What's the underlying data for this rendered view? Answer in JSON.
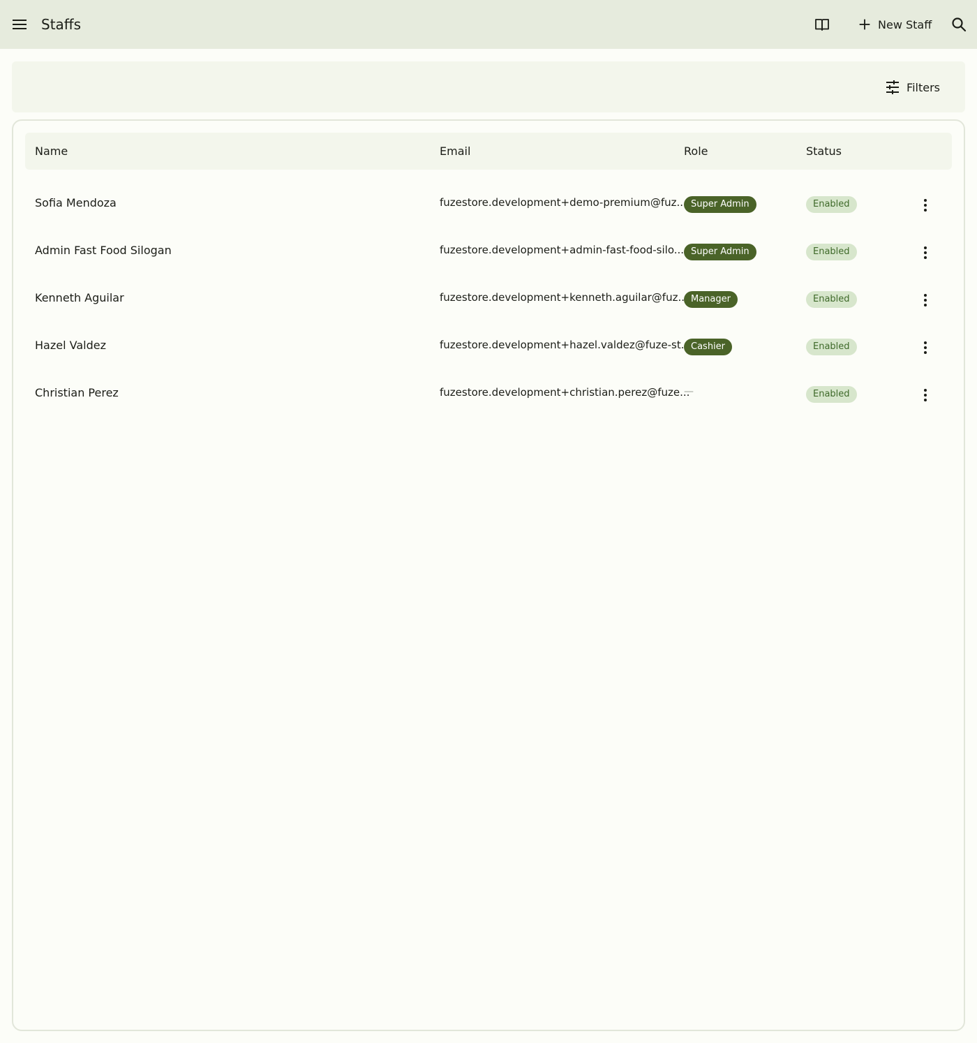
{
  "app": {
    "title": "Staffs",
    "new_staff_label": "New Staff"
  },
  "icons": {
    "menu": "menu-icon",
    "guide": "book-open-icon",
    "add": "plus-icon",
    "search": "search-icon",
    "filters": "tune-icon",
    "row_menu": "more-vertical-icon"
  },
  "filter_bar": {
    "filters_label": "Filters"
  },
  "table": {
    "columns": [
      "Name",
      "Email",
      "Role",
      "Status"
    ],
    "rows": [
      {
        "name": "Sofia Mendoza",
        "email": "fuzestore.development+demo-premium@fuz...",
        "role": "Super Admin",
        "status": "Enabled"
      },
      {
        "name": "Admin Fast Food Silogan",
        "email": "fuzestore.development+admin-fast-food-silo...",
        "role": "Super Admin",
        "status": "Enabled"
      },
      {
        "name": "Kenneth Aguilar",
        "email": "fuzestore.development+kenneth.aguilar@fuz...",
        "role": "Manager",
        "status": "Enabled"
      },
      {
        "name": "Hazel Valdez",
        "email": "fuzestore.development+hazel.valdez@fuze-st...",
        "role": "Cashier",
        "status": "Enabled"
      },
      {
        "name": "Christian Perez",
        "email": "fuzestore.development+christian.perez@fuze...",
        "role": "—",
        "status": "Enabled"
      }
    ]
  },
  "colors": {
    "topbar_bg": "#e6ebdd",
    "role_chip_bg": "#4a6328",
    "status_chip_bg": "#d7e6cc",
    "status_chip_text": "#3f6a2a"
  }
}
